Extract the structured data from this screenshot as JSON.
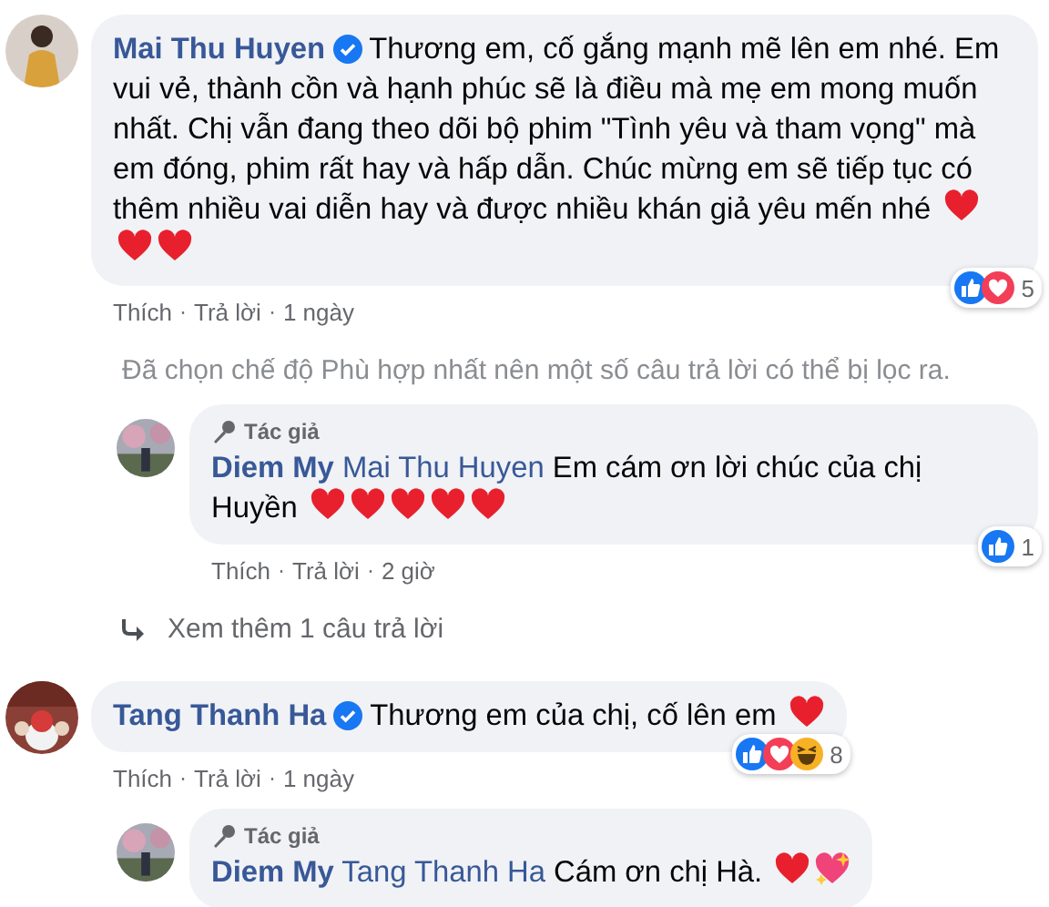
{
  "separator": "·",
  "comments": [
    {
      "author": "Mai Thu Huyen",
      "verified": true,
      "text": "Thương em, cố gắng mạnh mẽ lên em nhé. Em vui vẻ, thành cồn và hạnh phúc sẽ là điều mà mẹ em mong muốn nhất. Chị vẫn đang theo dõi bộ phim \"Tình yêu và tham vọng\" mà em đóng, phim rất hay và hấp dẫn. Chúc mừng em sẽ tiếp tục có thêm nhiều vai diễn hay và được nhiều khán giả yêu mến nhé",
      "emoji": [
        {
          "kind": "heart"
        },
        {
          "kind": "heart"
        },
        {
          "kind": "heart"
        }
      ],
      "actions": [
        "Thích",
        "Trả lời"
      ],
      "time": "1 ngày",
      "reactions": {
        "icons": [
          {
            "kind": "like"
          },
          {
            "kind": "love"
          }
        ],
        "count": "5"
      },
      "filter_notice": "Đã chọn chế độ Phù hợp nhất nên một số câu trả lời có thể bị lọc ra.",
      "replies": [
        {
          "badge": "Tác giả",
          "author": "Diem My",
          "mention": "Mai Thu Huyen",
          "text": "Em cám ơn lời chúc của chị Huyền",
          "emoji": [
            {
              "kind": "heart"
            },
            {
              "kind": "heart"
            },
            {
              "kind": "heart"
            },
            {
              "kind": "heart"
            },
            {
              "kind": "heart"
            }
          ],
          "actions": [
            "Thích",
            "Trả lời"
          ],
          "time": "2 giờ",
          "reactions": {
            "icons": [
              {
                "kind": "like"
              }
            ],
            "count": "1"
          }
        }
      ],
      "more_replies": "Xem thêm 1 câu trả lời"
    },
    {
      "author": "Tang Thanh Ha",
      "verified": true,
      "text": "Thương em của chị, cố lên em",
      "emoji": [
        {
          "kind": "heart"
        }
      ],
      "actions": [
        "Thích",
        "Trả lời"
      ],
      "time": "1 ngày",
      "reactions": {
        "icons": [
          {
            "kind": "like"
          },
          {
            "kind": "love"
          },
          {
            "kind": "haha"
          }
        ],
        "count": "8"
      },
      "replies": [
        {
          "badge": "Tác giả",
          "author": "Diem My",
          "mention": "Tang Thanh Ha",
          "text": "Cám ơn chị Hà.",
          "emoji": [
            {
              "kind": "heart"
            },
            {
              "kind": "sparkle-heart"
            }
          ]
        }
      ]
    }
  ]
}
